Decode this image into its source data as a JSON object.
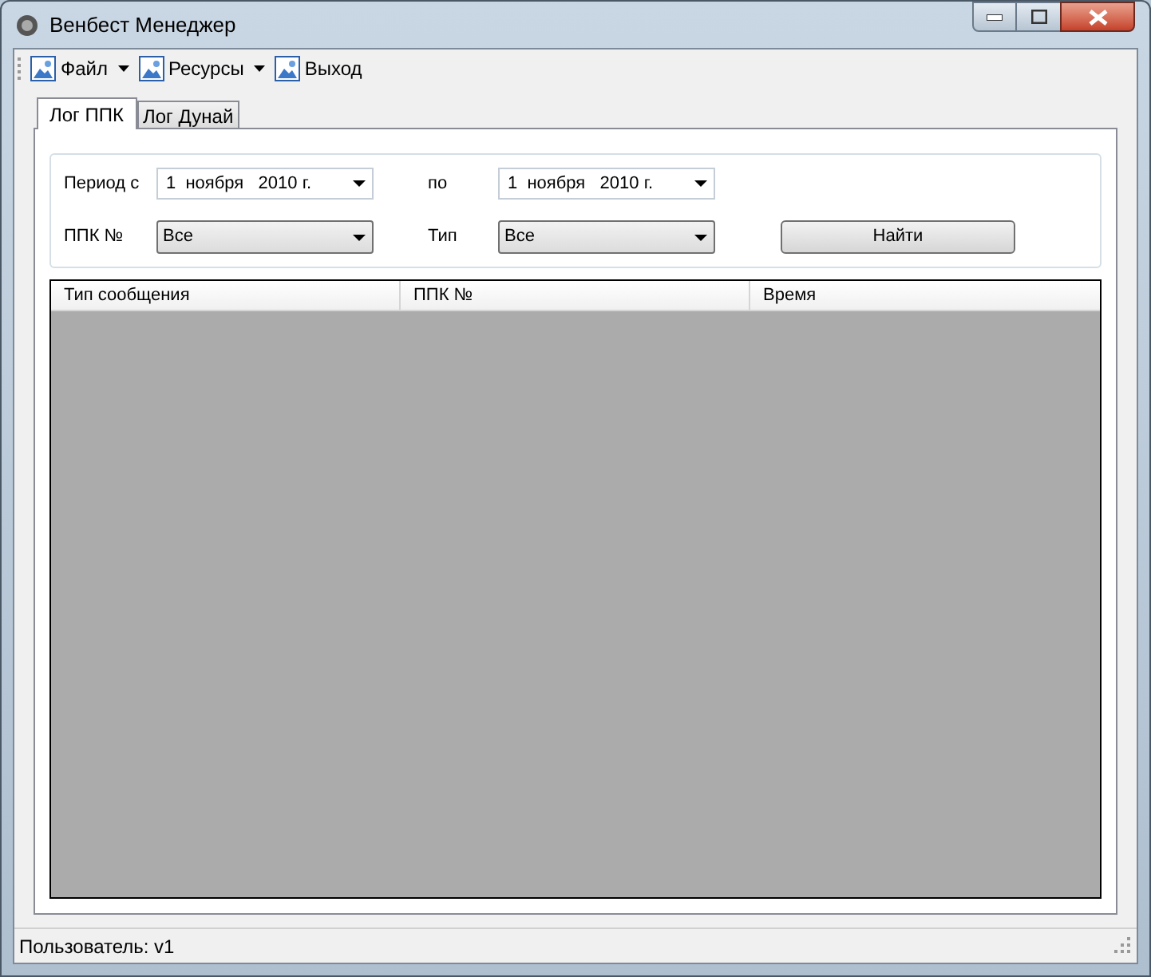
{
  "window": {
    "title": "Венбест Менеджер"
  },
  "menu": [
    {
      "label": "Файл",
      "has_dropdown": true
    },
    {
      "label": "Ресурсы",
      "has_dropdown": true
    },
    {
      "label": "Выход",
      "has_dropdown": false
    }
  ],
  "tabs": [
    {
      "label": "Лог ППК",
      "selected": true
    },
    {
      "label": "Лог Дунай",
      "selected": false
    }
  ],
  "filters": {
    "period_from_label": "Период с",
    "period_from": "1  ноября   2010 г.",
    "period_to_label": "по",
    "period_to": "1  ноября   2010 г.",
    "ppk_label": "ППК №",
    "ppk_value": "Все",
    "type_label": "Тип",
    "type_value": "Все",
    "find_button": "Найти"
  },
  "table": {
    "columns": [
      "Тип сообщения",
      "ППК №",
      "Время"
    ]
  },
  "status_bar": "Пользователь: v1"
}
